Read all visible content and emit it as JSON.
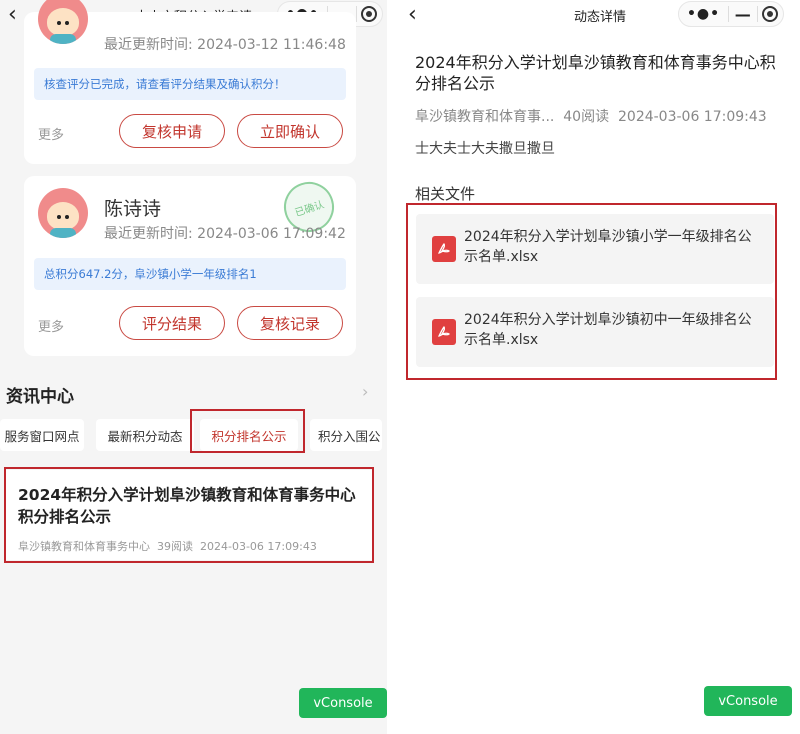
{
  "left": {
    "nav_title": "中山市积分入学申请",
    "cards": [
      {
        "updated_label": "最近更新时间: ",
        "updated_time": "2024-03-12 11:46:48",
        "notice": "核查评分已完成，请查看评分结果及确认积分！",
        "more": "更多",
        "buttons": [
          "复核申请",
          "立即确认"
        ]
      },
      {
        "name": "陈诗诗",
        "stamp": "已确认",
        "updated_label": "最近更新时间: ",
        "updated_time": "2024-03-06 17:09:42",
        "notice": "总积分647.2分，阜沙镇小学一年级排名1",
        "more": "更多",
        "buttons": [
          "评分结果",
          "复核记录"
        ]
      }
    ],
    "section_title": "资讯中心",
    "tabs": [
      "服务窗口网点",
      "最新积分动态",
      "积分排名公示",
      "积分入围公"
    ],
    "news": {
      "title": "2024年积分入学计划阜沙镇教育和体育事务中心积分排名公示",
      "source": "阜沙镇教育和体育事务中心",
      "reads": "39阅读",
      "time": "2024-03-06 17:09:43"
    },
    "vconsole": "vConsole"
  },
  "right": {
    "nav_title": "动态详情",
    "article": {
      "title": "2024年积分入学计划阜沙镇教育和体育事务中心积分排名公示",
      "source": "阜沙镇教育和体育事...",
      "reads": "40阅读",
      "time": "2024-03-06 17:09:43",
      "body": "士大夫士大夫撒旦撒旦"
    },
    "related_title": "相关文件",
    "files": [
      "2024年积分入学计划阜沙镇小学一年级排名公示名单.xlsx",
      "2024年积分入学计划阜沙镇初中一年级排名公示名单.xlsx"
    ],
    "vconsole": "vConsole"
  },
  "colors": {
    "accent_red": "#c2352d",
    "highlight_red": "#c0272d",
    "vconsole_green": "#21b65a",
    "notice_blue": "#3a7bd5"
  },
  "icons": {
    "back": "chevron-left-icon",
    "more": "more-dots-icon",
    "minimize": "minimize-icon",
    "close": "close-circle-icon",
    "file": "pdf-file-icon",
    "arrow": "chevron-right-icon"
  }
}
